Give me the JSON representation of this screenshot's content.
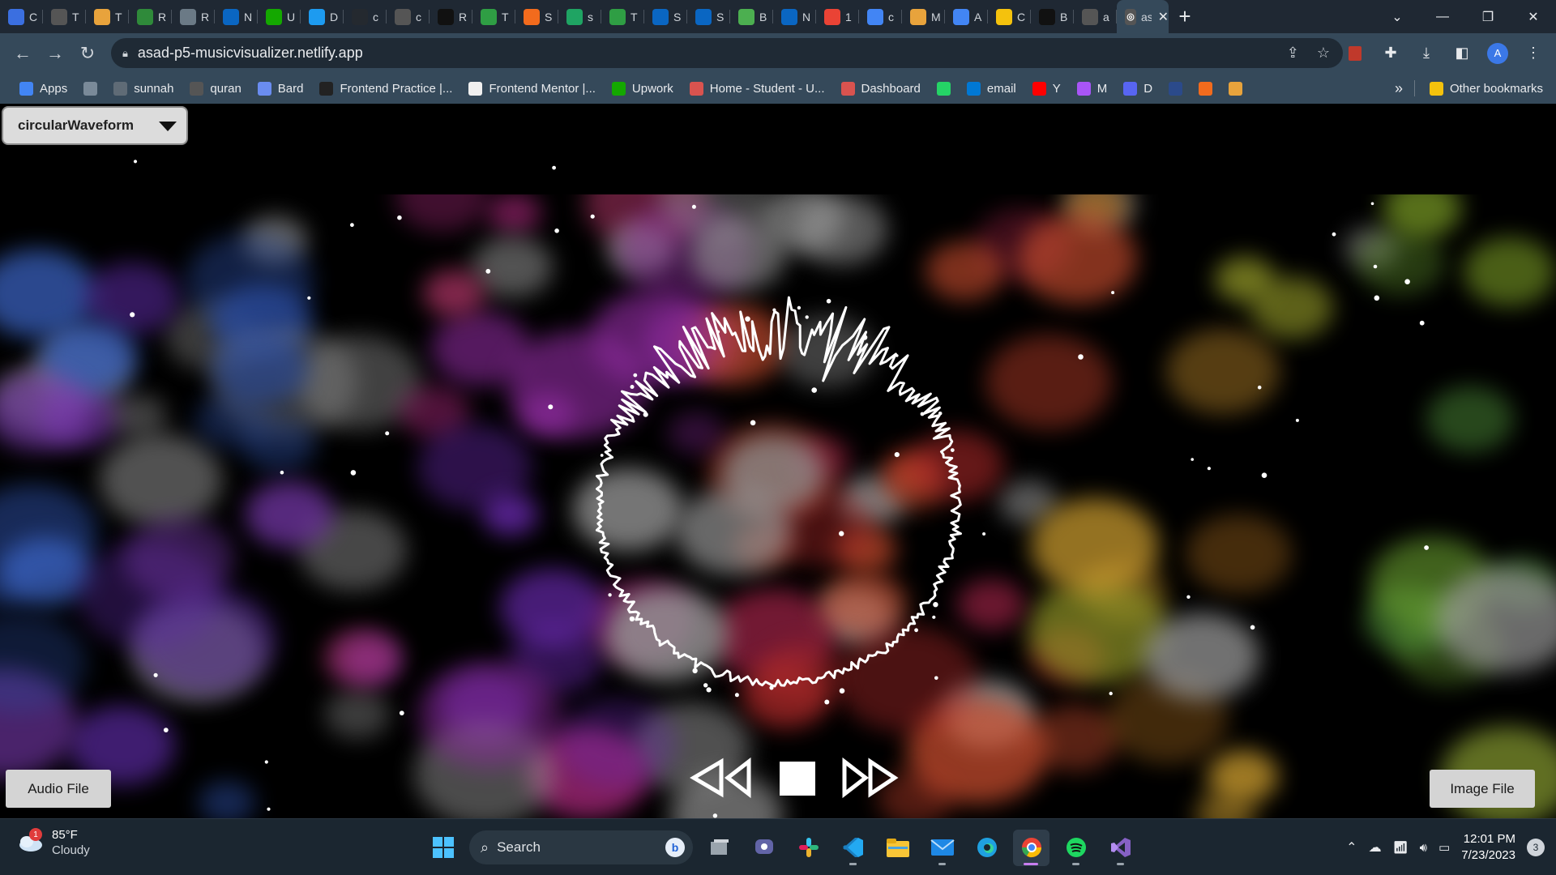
{
  "browser": {
    "tabs": [
      {
        "title": "C",
        "icon": "chrome-blue-icon",
        "color": "#3b6fe0"
      },
      {
        "title": "T",
        "icon": "globe-icon",
        "color": "#555"
      },
      {
        "title": "T",
        "icon": "pinwheel-icon",
        "color": "#e8a33c"
      },
      {
        "title": "R",
        "icon": "w-logo-icon",
        "color": "#2f8a3a"
      },
      {
        "title": "R",
        "icon": "openai-icon",
        "color": "#6b7a86"
      },
      {
        "title": "N",
        "icon": "linkedin-icon",
        "color": "#0a66c2"
      },
      {
        "title": "U",
        "icon": "upwork-icon",
        "color": "#14a800"
      },
      {
        "title": "D",
        "icon": "bird-icon",
        "color": "#1d9bf0"
      },
      {
        "title": "c",
        "icon": "github-icon",
        "color": "#24292f"
      },
      {
        "title": "c",
        "icon": "square-icon",
        "color": "#555"
      },
      {
        "title": "R",
        "icon": "square-black-icon",
        "color": "#111"
      },
      {
        "title": "T",
        "icon": "px-icon",
        "color": "#2f9e44"
      },
      {
        "title": "S",
        "icon": "orange-icon",
        "color": "#f26b1d"
      },
      {
        "title": "s",
        "icon": "drive-icon",
        "color": "#1fa463"
      },
      {
        "title": "T",
        "icon": "px-icon",
        "color": "#2f9e44"
      },
      {
        "title": "S",
        "icon": "linkedin-icon",
        "color": "#0a66c2"
      },
      {
        "title": "S",
        "icon": "linkedin-icon",
        "color": "#0a66c2"
      },
      {
        "title": "B",
        "icon": "green-b-icon",
        "color": "#4caf50"
      },
      {
        "title": "N",
        "icon": "linkedin-icon",
        "color": "#0a66c2"
      },
      {
        "title": "1",
        "icon": "google-icon",
        "color": "#ea4335"
      },
      {
        "title": "c",
        "icon": "docs-icon",
        "color": "#4285f4"
      },
      {
        "title": "M",
        "icon": "pinwheel-icon",
        "color": "#e8a33c"
      },
      {
        "title": "A",
        "icon": "docs-icon",
        "color": "#4285f4"
      },
      {
        "title": "C",
        "icon": "yellow-icon",
        "color": "#f4c20d"
      },
      {
        "title": "B",
        "icon": "square-black-icon",
        "color": "#111"
      },
      {
        "title": "a",
        "icon": "globe-icon",
        "color": "#555"
      }
    ],
    "active_tab_title": "as",
    "new_tab": "+",
    "url": "asad-p5-musicvisualizer.netlify.app",
    "profile_initial": "A",
    "bookmarks": [
      {
        "label": "Apps",
        "icon": "apps-grid-icon",
        "color": "#4285f4"
      },
      {
        "label": "",
        "icon": "image-bookmark-icon",
        "color": "#7a8a99"
      },
      {
        "label": "sunnah",
        "icon": "gear-bookmark-icon",
        "color": "#5f6b76"
      },
      {
        "label": "quran",
        "icon": "globe-icon",
        "color": "#555"
      },
      {
        "label": "Bard",
        "icon": "sparkle-icon",
        "color": "#6a8cf0"
      },
      {
        "label": "Frontend Practice |...",
        "icon": "fp-icon",
        "color": "#222"
      },
      {
        "label": "Frontend Mentor |...",
        "icon": "fm-icon",
        "color": "#f0f0f0"
      },
      {
        "label": "Upwork",
        "icon": "upwork-icon",
        "color": "#14a800"
      },
      {
        "label": "Home - Student - U...",
        "icon": "student-icon",
        "color": "#d9534f"
      },
      {
        "label": "Dashboard",
        "icon": "student-icon",
        "color": "#d9534f"
      },
      {
        "label": "",
        "icon": "whatsapp-icon",
        "color": "#25d366"
      },
      {
        "label": "email",
        "icon": "outlook-icon",
        "color": "#0078d4"
      },
      {
        "label": "Y",
        "icon": "youtube-icon",
        "color": "#ff0000"
      },
      {
        "label": "M",
        "icon": "messenger-icon",
        "color": "#a855f7"
      },
      {
        "label": "D",
        "icon": "discord-icon",
        "color": "#5865f2"
      },
      {
        "label": "",
        "icon": "wz-icon",
        "color": "#2b4a8a"
      },
      {
        "label": "",
        "icon": "orange-icon",
        "color": "#f26b1d"
      },
      {
        "label": "",
        "icon": "pinwheel-icon",
        "color": "#e8a33c"
      }
    ],
    "more_bookmarks": "»",
    "other_bookmarks": "Other bookmarks"
  },
  "visualizer": {
    "mode_select": "circularWaveform",
    "audio_button": "Audio File",
    "image_button": "Image File"
  },
  "taskbar": {
    "weather_temp": "85°F",
    "weather_cond": "Cloudy",
    "weather_badge": "1",
    "search_placeholder": "Search",
    "time": "12:01 PM",
    "date": "7/23/2023",
    "notif_count": "3",
    "apps": [
      "windows-start-icon",
      "task-view-icon",
      "teams-icon",
      "slack-icon",
      "vscode-icon",
      "file-explorer-icon",
      "mail-icon",
      "edge-icon",
      "chrome-icon",
      "spotify-icon",
      "visual-studio-icon"
    ]
  }
}
